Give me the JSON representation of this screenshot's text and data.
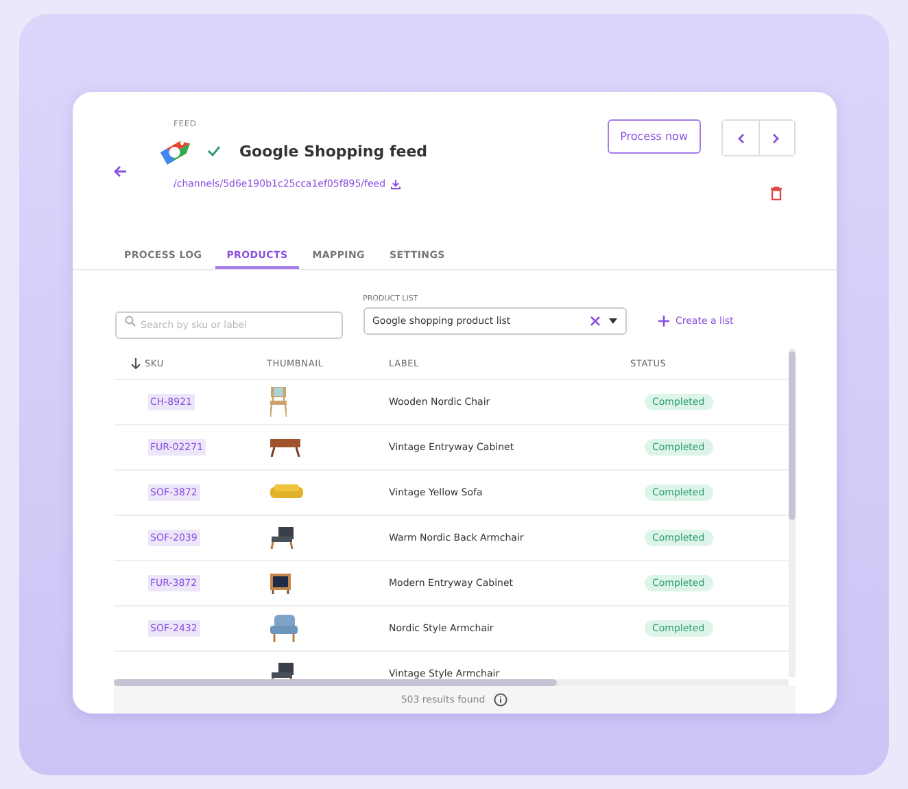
{
  "header": {
    "eyebrow": "FEED",
    "title": "Google Shopping feed",
    "verified": true,
    "link": "/channels/5d6e190b1c25cca1ef05f895/feed",
    "process_button": "Process now"
  },
  "tabs": [
    {
      "label": "PROCESS LOG",
      "selected": false
    },
    {
      "label": "PRODUCTS",
      "selected": true
    },
    {
      "label": "MAPPING",
      "selected": false
    },
    {
      "label": "SETTINGS",
      "selected": false
    }
  ],
  "search": {
    "placeholder": "Search by sku or label"
  },
  "product_list": {
    "label": "PRODUCT LIST",
    "value": "Google shopping product list"
  },
  "create_list": "Create a list",
  "table": {
    "columns": [
      "SKU",
      "THUMBNAIL",
      "LABEL",
      "STATUS"
    ],
    "rows": [
      {
        "sku": "CH-8921",
        "kind": "chair",
        "label": "Wooden Nordic Chair",
        "status": "Completed"
      },
      {
        "sku": "FUR-02271",
        "kind": "cabinet",
        "label": "Vintage Entryway Cabinet",
        "status": "Completed"
      },
      {
        "sku": "SOF-3872",
        "kind": "sofa",
        "label": "Vintage Yellow Sofa",
        "status": "Completed"
      },
      {
        "sku": "SOF-2039",
        "kind": "armchair",
        "label": "Warm Nordic Back Armchair",
        "status": "Completed"
      },
      {
        "sku": "FUR-3872",
        "kind": "tv-cabinet",
        "label": "Modern Entryway Cabinet",
        "status": "Completed"
      },
      {
        "sku": "SOF-2432",
        "kind": "blue-armchair",
        "label": "Nordic Style Armchair",
        "status": "Completed"
      },
      {
        "kind": "armchair",
        "label": "Vintage Style Armchair"
      }
    ]
  },
  "footer": {
    "results": "503 results found"
  }
}
